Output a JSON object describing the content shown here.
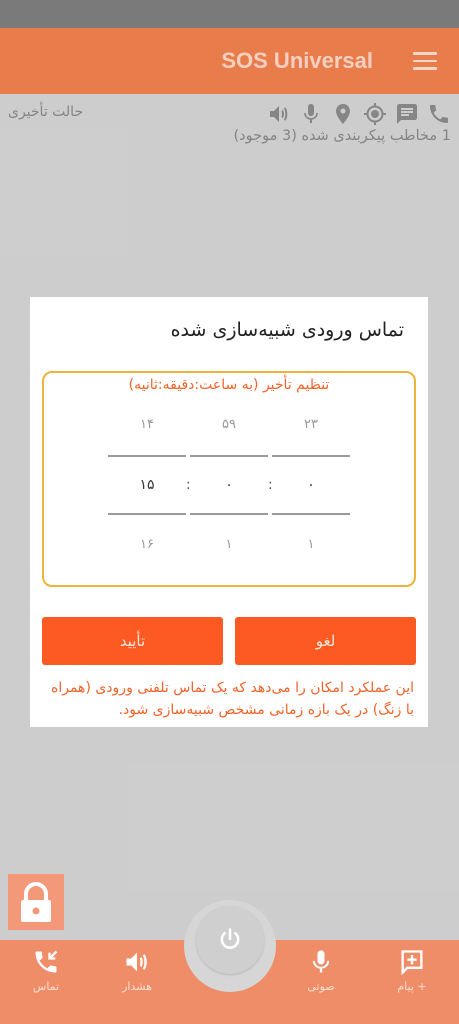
{
  "app": {
    "title": "SOS Universal"
  },
  "status": {
    "delay_mode": "حالت تأخیری",
    "contacts_configured": "1 مخاطب پیکربندی شده (3 موجود)",
    "icons": [
      "phone-icon",
      "message-icon",
      "gps-target-icon",
      "location-pin-icon",
      "microphone-icon",
      "alarm-speaker-icon"
    ]
  },
  "dialog": {
    "title": "تماس ورودی شبیه‌سازی شده",
    "picker_label": "تنظیم تأخیر (به ساعت:دقیقه:ثانیه)",
    "hours": {
      "prev": "۲۳",
      "value": "۰",
      "next": "۱"
    },
    "minutes": {
      "prev": "۵۹",
      "value": "۰",
      "next": "۱"
    },
    "seconds": {
      "prev": "۱۴",
      "value": "۱۵",
      "next": "۱۶"
    },
    "separator": ":",
    "cancel_label": "لغو",
    "confirm_label": "تأیید",
    "description": "این عملکرد امکان را می‌دهد که یک تماس تلفنی ورودی (همراه با زنگ) در یک بازه زمانی مشخص شبیه‌سازی شود."
  },
  "bottom_nav": {
    "items": [
      {
        "label": "پیام +",
        "icon": "add-message-icon"
      },
      {
        "label": "صوتی",
        "icon": "microphone-icon"
      },
      {
        "label": "هشدار",
        "icon": "alarm-speaker-icon"
      },
      {
        "label": "تماس",
        "icon": "missed-call-icon"
      }
    ],
    "power_icon": "power-icon",
    "lock_icon": "lock-icon"
  },
  "colors": {
    "app_bar": "#f3824f",
    "accent": "#fc5a22",
    "picker_border": "#f0b33a",
    "warning_text": "#f0642a"
  }
}
